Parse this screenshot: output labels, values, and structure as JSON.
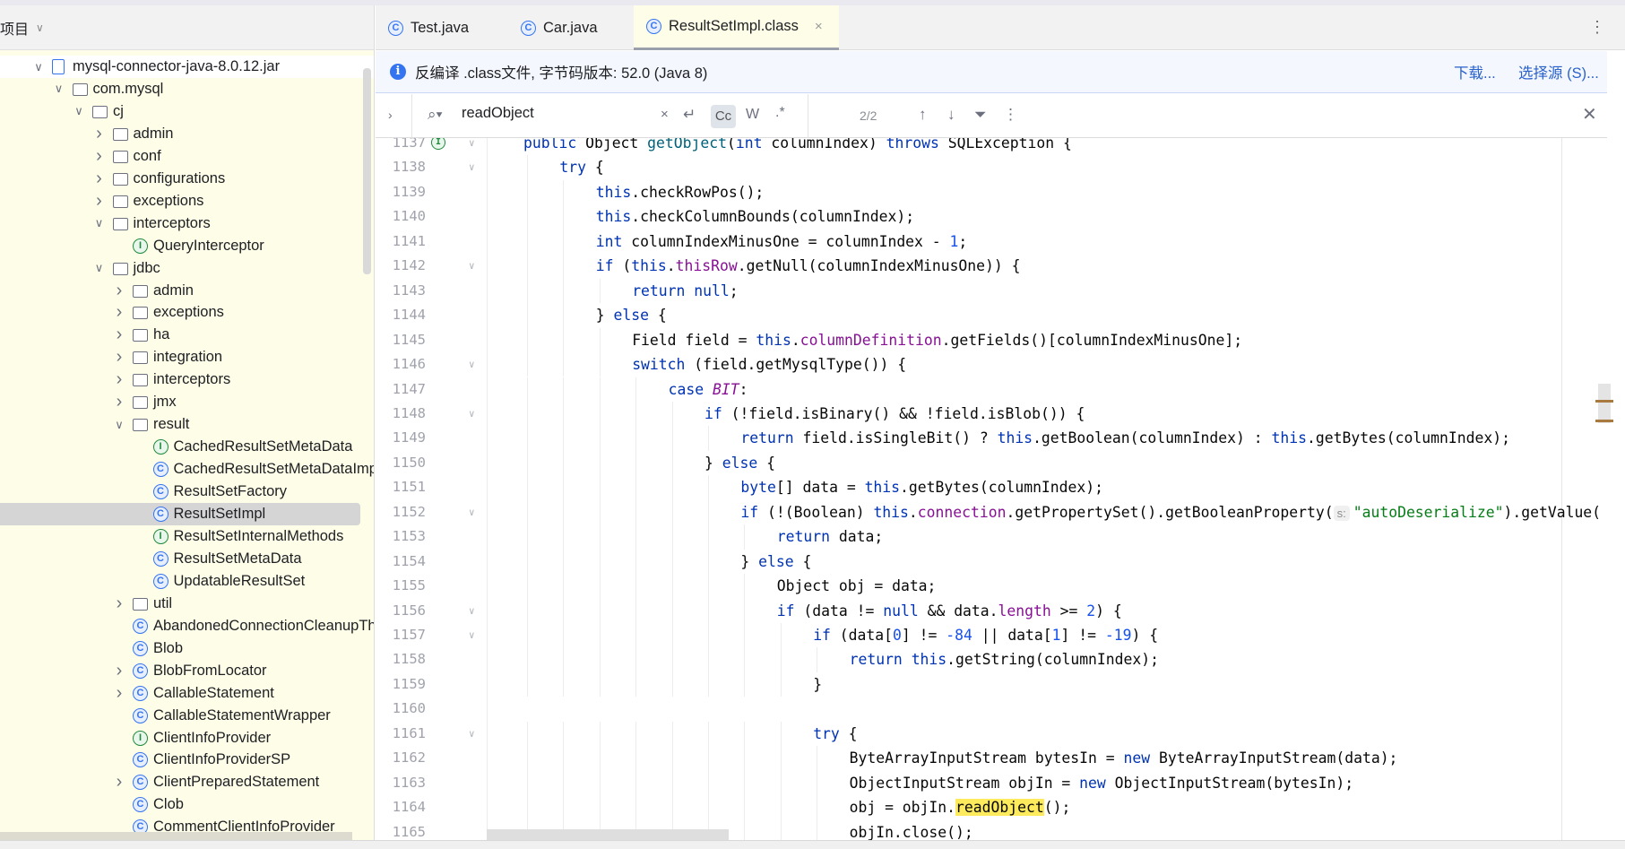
{
  "project_panel": {
    "title": "项目",
    "tree": [
      {
        "label": "mysql-connector-java-8.0.12.jar",
        "level": 0,
        "icon": "jar-icon",
        "state": "expanded"
      },
      {
        "label": "com.mysql",
        "level": 1,
        "icon": "folder-icon",
        "state": "expanded"
      },
      {
        "label": "cj",
        "level": 2,
        "icon": "folder-icon",
        "state": "expanded"
      },
      {
        "label": "admin",
        "level": 3,
        "icon": "folder-icon",
        "state": "collapsed"
      },
      {
        "label": "conf",
        "level": 3,
        "icon": "folder-icon",
        "state": "collapsed"
      },
      {
        "label": "configurations",
        "level": 3,
        "icon": "folder-icon",
        "state": "collapsed"
      },
      {
        "label": "exceptions",
        "level": 3,
        "icon": "folder-icon",
        "state": "collapsed"
      },
      {
        "label": "interceptors",
        "level": 3,
        "icon": "folder-icon",
        "state": "expanded"
      },
      {
        "label": "QueryInterceptor",
        "level": 4,
        "icon": "interface-icon",
        "state": "leaf"
      },
      {
        "label": "jdbc",
        "level": 3,
        "icon": "folder-icon",
        "state": "expanded"
      },
      {
        "label": "admin",
        "level": 4,
        "icon": "folder-icon",
        "state": "collapsed"
      },
      {
        "label": "exceptions",
        "level": 4,
        "icon": "folder-icon",
        "state": "collapsed"
      },
      {
        "label": "ha",
        "level": 4,
        "icon": "folder-icon",
        "state": "collapsed"
      },
      {
        "label": "integration",
        "level": 4,
        "icon": "folder-icon",
        "state": "collapsed"
      },
      {
        "label": "interceptors",
        "level": 4,
        "icon": "folder-icon",
        "state": "collapsed"
      },
      {
        "label": "jmx",
        "level": 4,
        "icon": "folder-icon",
        "state": "collapsed"
      },
      {
        "label": "result",
        "level": 4,
        "icon": "folder-icon",
        "state": "expanded"
      },
      {
        "label": "CachedResultSetMetaData",
        "level": 5,
        "icon": "interface-icon",
        "state": "leaf"
      },
      {
        "label": "CachedResultSetMetaDataImpl",
        "level": 5,
        "icon": "class-icon",
        "state": "leaf"
      },
      {
        "label": "ResultSetFactory",
        "level": 5,
        "icon": "class-icon",
        "state": "leaf"
      },
      {
        "label": "ResultSetImpl",
        "level": 5,
        "icon": "class-icon",
        "state": "leaf",
        "selected": true
      },
      {
        "label": "ResultSetInternalMethods",
        "level": 5,
        "icon": "interface-icon",
        "state": "leaf"
      },
      {
        "label": "ResultSetMetaData",
        "level": 5,
        "icon": "class-icon",
        "state": "leaf"
      },
      {
        "label": "UpdatableResultSet",
        "level": 5,
        "icon": "class-icon",
        "state": "leaf"
      },
      {
        "label": "util",
        "level": 4,
        "icon": "folder-icon",
        "state": "collapsed"
      },
      {
        "label": "AbandonedConnectionCleanupThread",
        "level": 4,
        "icon": "class-icon",
        "state": "leaf"
      },
      {
        "label": "Blob",
        "level": 4,
        "icon": "class-icon",
        "state": "leaf"
      },
      {
        "label": "BlobFromLocator",
        "level": 4,
        "icon": "class-icon",
        "state": "collapsed"
      },
      {
        "label": "CallableStatement",
        "level": 4,
        "icon": "class-icon",
        "state": "collapsed"
      },
      {
        "label": "CallableStatementWrapper",
        "level": 4,
        "icon": "class-icon",
        "state": "leaf"
      },
      {
        "label": "ClientInfoProvider",
        "level": 4,
        "icon": "interface-icon",
        "state": "leaf"
      },
      {
        "label": "ClientInfoProviderSP",
        "level": 4,
        "icon": "class-icon",
        "state": "leaf"
      },
      {
        "label": "ClientPreparedStatement",
        "level": 4,
        "icon": "class-icon",
        "state": "collapsed"
      },
      {
        "label": "Clob",
        "level": 4,
        "icon": "class-icon",
        "state": "leaf"
      },
      {
        "label": "CommentClientInfoProvider",
        "level": 4,
        "icon": "class-icon",
        "state": "leaf"
      }
    ]
  },
  "tabs": [
    {
      "label": "Test.java",
      "icon": "class-icon",
      "active": false
    },
    {
      "label": "Car.java",
      "icon": "class-icon",
      "active": false
    },
    {
      "label": "ResultSetImpl.class",
      "icon": "class-icon",
      "active": true,
      "close": "×"
    }
  ],
  "info_bar": {
    "message": "反编译 .class文件, 字节码版本: 52.0 (Java 8)",
    "download": "下载...",
    "choose_source": "选择源 (S)..."
  },
  "search": {
    "query": "readObject",
    "match_case": "Cc",
    "words": "W",
    "regex": ".*",
    "count": "2/2"
  },
  "colors": {
    "keyword": "#0033b3",
    "field": "#871094",
    "method": "#00627a",
    "number": "#1750eb",
    "string": "#067d17",
    "highlight": "#fdeb5d",
    "accent": "#3574f0"
  },
  "code": {
    "fold_lines": [
      1137,
      1138,
      1142,
      1146,
      1148,
      1152,
      1156,
      1157,
      1161
    ],
    "lines": [
      {
        "n": "1137",
        "indent": 0,
        "tokens": [
          [
            "public",
            "k"
          ],
          " Object ",
          [
            "getObject",
            "m"
          ],
          "(",
          [
            "int",
            "k"
          ],
          " columnIndex) ",
          [
            "throws",
            "k"
          ],
          " SQLException {"
        ]
      },
      {
        "n": "1138",
        "indent": 1,
        "tokens": [
          [
            "try",
            "k"
          ],
          " {"
        ]
      },
      {
        "n": "1139",
        "indent": 2,
        "tokens": [
          [
            "this",
            "k"
          ],
          ".checkRowPos();"
        ]
      },
      {
        "n": "1140",
        "indent": 2,
        "tokens": [
          [
            "this",
            "k"
          ],
          ".checkColumnBounds(columnIndex);"
        ]
      },
      {
        "n": "1141",
        "indent": 2,
        "tokens": [
          [
            "int",
            "k"
          ],
          " columnIndexMinusOne = columnIndex - ",
          [
            "1",
            "n"
          ],
          ";"
        ]
      },
      {
        "n": "1142",
        "indent": 2,
        "tokens": [
          [
            "if",
            "k"
          ],
          " (",
          [
            "this",
            "k"
          ],
          ".",
          [
            "thisRow",
            "f"
          ],
          ".getNull(columnIndexMinusOne)) {"
        ]
      },
      {
        "n": "1143",
        "indent": 3,
        "tokens": [
          [
            "return",
            "k"
          ],
          " ",
          [
            "null",
            "k"
          ],
          ";"
        ]
      },
      {
        "n": "1144",
        "indent": 2,
        "tokens": [
          "} ",
          [
            "else",
            "k"
          ],
          " {"
        ]
      },
      {
        "n": "1145",
        "indent": 3,
        "tokens": [
          "Field field = ",
          [
            "this",
            "k"
          ],
          ".",
          [
            "columnDefinition",
            "f"
          ],
          ".getFields()[columnIndexMinusOne];"
        ]
      },
      {
        "n": "1146",
        "indent": 3,
        "tokens": [
          [
            "switch",
            "k"
          ],
          " (field.getMysqlType()) {"
        ]
      },
      {
        "n": "1147",
        "indent": 4,
        "tokens": [
          [
            "case",
            "k"
          ],
          " ",
          [
            "BIT",
            "i"
          ],
          ":"
        ]
      },
      {
        "n": "1148",
        "indent": 5,
        "tokens": [
          [
            "if",
            "k"
          ],
          " (!field.isBinary() && !field.isBlob()) {"
        ]
      },
      {
        "n": "1149",
        "indent": 6,
        "tokens": [
          [
            "return",
            "k"
          ],
          " field.isSingleBit() ? ",
          [
            "this",
            "k"
          ],
          ".getBoolean(columnIndex) : ",
          [
            "this",
            "k"
          ],
          ".getBytes(columnIndex);"
        ]
      },
      {
        "n": "1150",
        "indent": 5,
        "tokens": [
          "} ",
          [
            "else",
            "k"
          ],
          " {"
        ]
      },
      {
        "n": "1151",
        "indent": 6,
        "tokens": [
          [
            "byte",
            "k"
          ],
          "[] data = ",
          [
            "this",
            "k"
          ],
          ".getBytes(columnIndex);"
        ]
      },
      {
        "n": "1152",
        "indent": 6,
        "tokens": [
          [
            "if",
            "k"
          ],
          " (!(Boolean) ",
          [
            "this",
            "k"
          ],
          ".",
          [
            "connection",
            "f"
          ],
          ".getPropertySet().getBooleanProperty(",
          [
            "s:",
            "hint"
          ],
          [
            "\"autoDeserialize\"",
            "s"
          ],
          ").getValue("
        ]
      },
      {
        "n": "1153",
        "indent": 7,
        "tokens": [
          [
            "return",
            "k"
          ],
          " data;"
        ]
      },
      {
        "n": "1154",
        "indent": 6,
        "tokens": [
          "} ",
          [
            "else",
            "k"
          ],
          " {"
        ]
      },
      {
        "n": "1155",
        "indent": 7,
        "tokens": [
          "Object obj = data;"
        ]
      },
      {
        "n": "1156",
        "indent": 7,
        "tokens": [
          [
            "if",
            "k"
          ],
          " (data != ",
          [
            "null",
            "k"
          ],
          " && data.",
          [
            "length",
            "f"
          ],
          " >= ",
          [
            "2",
            "n"
          ],
          ") {"
        ]
      },
      {
        "n": "1157",
        "indent": 8,
        "tokens": [
          [
            "if",
            "k"
          ],
          " (data[",
          [
            "0",
            "n"
          ],
          "] != ",
          [
            "-84",
            "n"
          ],
          " || data[",
          [
            "1",
            "n"
          ],
          "] != ",
          [
            "-19",
            "n"
          ],
          ") {"
        ]
      },
      {
        "n": "1158",
        "indent": 9,
        "tokens": [
          [
            "return",
            "k"
          ],
          " ",
          [
            "this",
            "k"
          ],
          ".getString(columnIndex);"
        ]
      },
      {
        "n": "1159",
        "indent": 8,
        "tokens": [
          "}"
        ]
      },
      {
        "n": "1160",
        "indent": 0,
        "tokens": []
      },
      {
        "n": "1161",
        "indent": 8,
        "tokens": [
          [
            "try",
            "k"
          ],
          " {"
        ]
      },
      {
        "n": "1162",
        "indent": 9,
        "tokens": [
          "ByteArrayInputStream bytesIn = ",
          [
            "new",
            "k"
          ],
          " ByteArrayInputStream(data);"
        ]
      },
      {
        "n": "1163",
        "indent": 9,
        "tokens": [
          "ObjectInputStream objIn = ",
          [
            "new",
            "k"
          ],
          " ObjectInputStream(bytesIn);"
        ]
      },
      {
        "n": "1164",
        "indent": 9,
        "tokens": [
          "obj = objIn.",
          [
            "readObject",
            "h"
          ],
          "();"
        ]
      },
      {
        "n": "1165",
        "indent": 9,
        "tokens": [
          "objIn.close();"
        ]
      }
    ]
  }
}
